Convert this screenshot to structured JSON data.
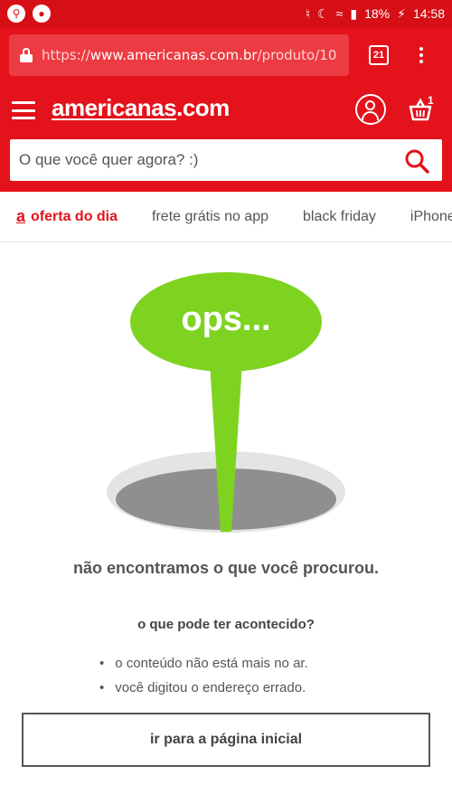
{
  "status_bar": {
    "battery": "18%",
    "time": "14:58"
  },
  "browser": {
    "url_scheme": "https://",
    "url_host": "www.americanas.com.br",
    "url_path": "/produto/10",
    "tab_count": "21"
  },
  "header": {
    "logo_main": "americanas",
    "logo_suffix": ".com",
    "cart_count": "1",
    "search_placeholder": "O que você quer agora? :)"
  },
  "categories": {
    "deal_icon": "a",
    "items": [
      "oferta do dia",
      "frete grátis no app",
      "black friday",
      "iPhone"
    ]
  },
  "error": {
    "bubble": "ops...",
    "title": "não encontramos o que você procurou.",
    "subtitle": "o que pode ter acontecido?",
    "reasons": [
      "o conteúdo não está mais no ar.",
      "você digitou o endereço errado."
    ],
    "button": "ir para a página inicial"
  },
  "colors": {
    "brand_red": "#e3121b",
    "bubble_green": "#7ed321",
    "hole_gray": "#8f8f8f"
  },
  "icons": [
    "search-icon",
    "lock-icon",
    "menu-icon",
    "user-icon",
    "basket-icon",
    "more-icon",
    "wifi-icon",
    "battery-icon"
  ]
}
